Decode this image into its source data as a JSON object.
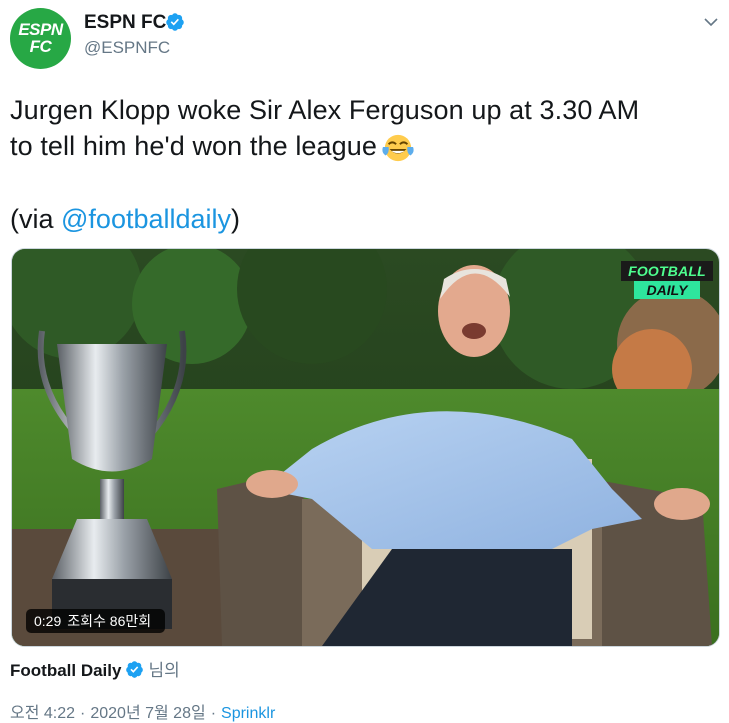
{
  "author": {
    "avatar_text_top": "ESPN",
    "avatar_text_bottom": "FC",
    "name": "ESPN FC",
    "handle": "@ESPNFC"
  },
  "tweet": {
    "line1": "Jurgen Klopp woke Sir Alex Ferguson up at 3.30 AM",
    "line2": "to tell him he'd won the league",
    "emoji": "face-with-tears-of-joy-icon",
    "via_prefix": "(via ",
    "via_handle": "@footballdaily",
    "via_suffix": ")"
  },
  "media": {
    "watermark_top": "FOOTBALL",
    "watermark_bottom": "DAILY",
    "duration": "0:29",
    "views": "조회수 86만회"
  },
  "attribution": {
    "name": "Football Daily",
    "suffix": "님의"
  },
  "meta": {
    "time": "오전 4:22",
    "date": "2020년 7월 28일",
    "source": "Sprinklr"
  },
  "colors": {
    "link": "#1b95e0",
    "verified": "#1da1f2",
    "muted": "#657786",
    "espn_green": "#27a845"
  }
}
